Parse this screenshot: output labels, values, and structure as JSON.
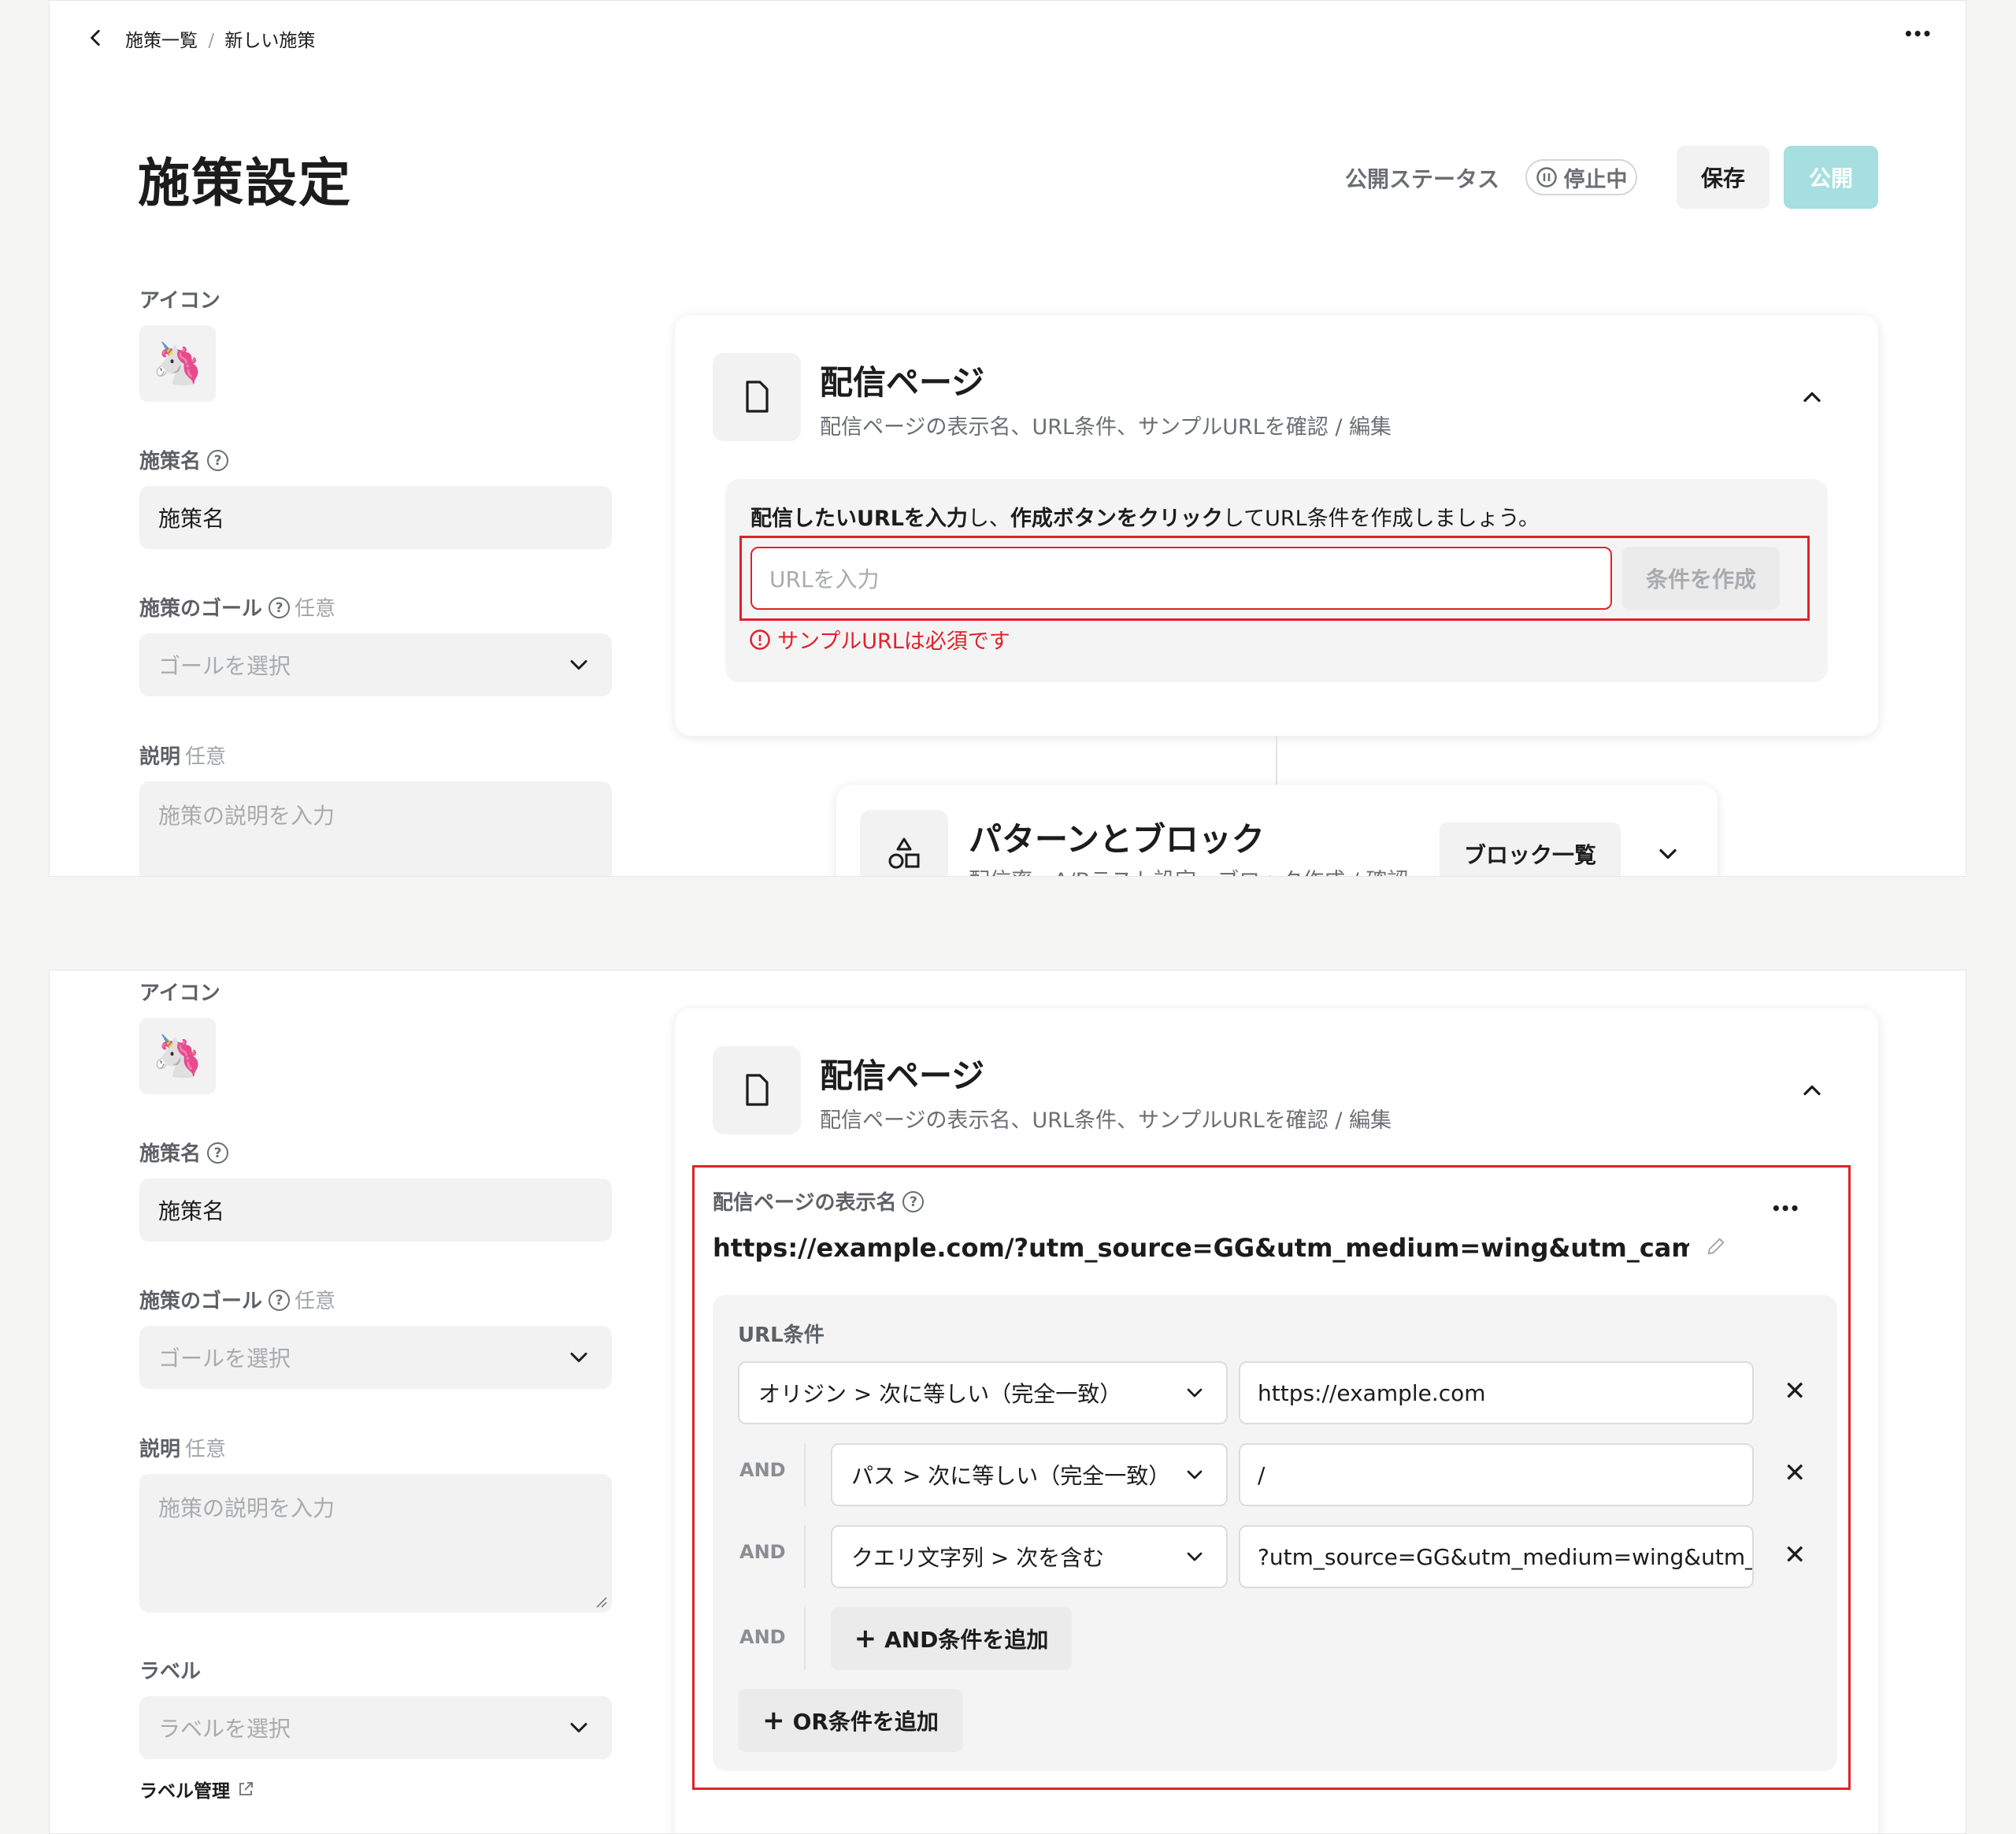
{
  "header": {
    "breadcrumb_parent": "施策一覧",
    "breadcrumb_separator": "/",
    "breadcrumb_current": "新しい施策",
    "more_label": "•••"
  },
  "page": {
    "title": "施策設定",
    "status_label": "公開ステータス",
    "status_badge": "停止中",
    "save_label": "保存",
    "publish_label": "公開"
  },
  "form": {
    "icon_label": "アイコン",
    "icon_emoji": "🦄",
    "name_label": "施策名",
    "name_value": "施策名",
    "goal_label": "施策のゴール",
    "goal_optional": "任意",
    "goal_placeholder": "ゴールを選択",
    "desc_label": "説明",
    "desc_optional": "任意",
    "desc_placeholder": "施策の説明を入力",
    "label_label": "ラベル",
    "label_placeholder": "ラベルを選択",
    "label_manage": "ラベル管理"
  },
  "delivery_card": {
    "title": "配信ページ",
    "subtitle": "配信ページの表示名、URL条件、サンプルURLを確認 / 編集",
    "instruction_bold1": "配信したいURLを入力",
    "instruction_mid1": "し、",
    "instruction_bold2": "作成ボタンをクリック",
    "instruction_mid2": "してURL条件を作成しましょう。",
    "url_placeholder": "URLを入力",
    "create_button": "条件を作成",
    "error_text": "サンプルURLは必須です",
    "display_name_label": "配信ページの表示名",
    "display_name_value": "https://example.com/?utm_source=GG&utm_medium=wing&utm_campaign=s...",
    "url_conditions_label": "URL条件",
    "conditions": [
      {
        "connector": "",
        "operator": "オリジン > 次に等しい（完全一致）",
        "value": "https://example.com"
      },
      {
        "connector": "AND",
        "operator": "パス > 次に等しい（完全一致）",
        "value": "/"
      },
      {
        "connector": "AND",
        "operator": "クエリ文字列 > 次を含む",
        "value": "?utm_source=GG&utm_medium=wing&utm_..."
      }
    ],
    "and_connector": "AND",
    "add_and_label": "AND条件を追加",
    "add_or_label": "OR条件を追加",
    "remove_glyph": "✕",
    "plus_glyph": "+"
  },
  "pattern_card": {
    "title": "パターンとブロック",
    "subtitle": "配信率、A/Bテスト設定、ブロック作成 / 確認",
    "block_list_label": "ブロック一覧"
  },
  "colors": {
    "accent": "#a6dfe0",
    "error": "#e0222b"
  }
}
